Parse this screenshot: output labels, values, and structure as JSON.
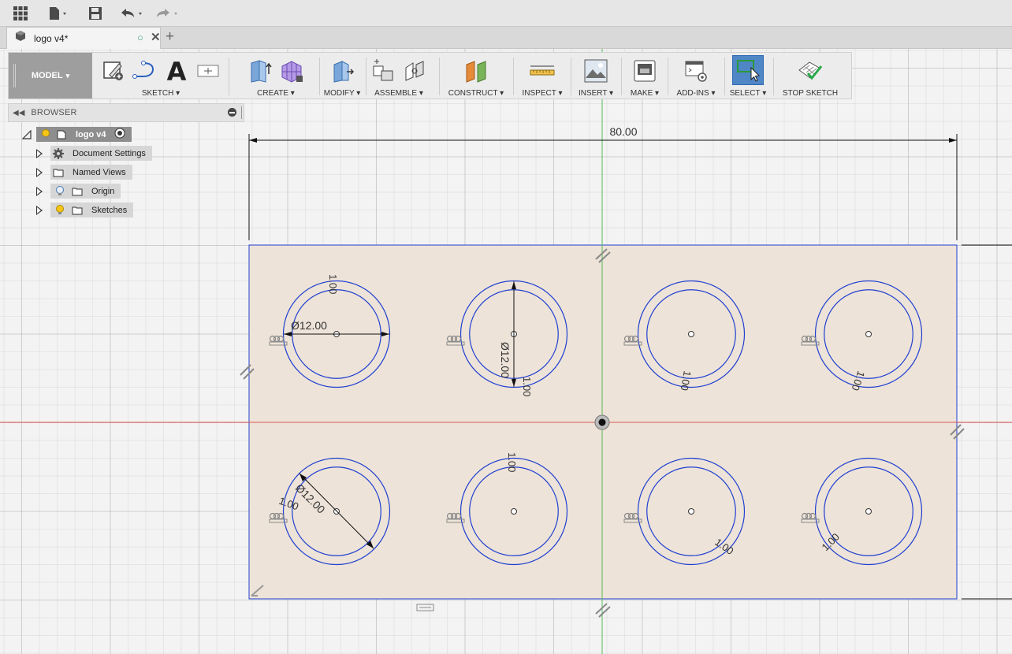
{
  "document": {
    "tab_title": "logo v4*"
  },
  "toolbar": {
    "mode": "MODEL",
    "groups": {
      "sketch": "SKETCH",
      "create": "CREATE",
      "modify": "MODIFY",
      "assemble": "ASSEMBLE",
      "construct": "CONSTRUCT",
      "inspect": "INSPECT",
      "insert": "INSERT",
      "make": "MAKE",
      "addins": "ADD-INS",
      "select": "SELECT",
      "stop_sketch": "STOP SKETCH"
    },
    "dropdown_suffix": "▾"
  },
  "browser": {
    "title": "BROWSER",
    "root": {
      "label": "logo v4"
    },
    "items": [
      {
        "label": "Document Settings",
        "icon": "gear-icon"
      },
      {
        "label": "Named Views",
        "icon": "folder-icon"
      },
      {
        "label": "Origin",
        "icon": "folder-icon",
        "bulb": "off"
      },
      {
        "label": "Sketches",
        "icon": "folder-icon",
        "bulb": "on"
      }
    ]
  },
  "sketch": {
    "overall_width_dimension": "80.00",
    "diameter_labels": [
      "Ø12.00",
      "Ø12.00",
      "Ø12.00"
    ],
    "offset_label": "1.00",
    "colors": {
      "profile_fill": "#ede3d8",
      "circle_stroke": "#1f3fd1",
      "x_axis": "#e05555",
      "y_axis": "#55bb55",
      "selection": "#4f86c6"
    }
  }
}
